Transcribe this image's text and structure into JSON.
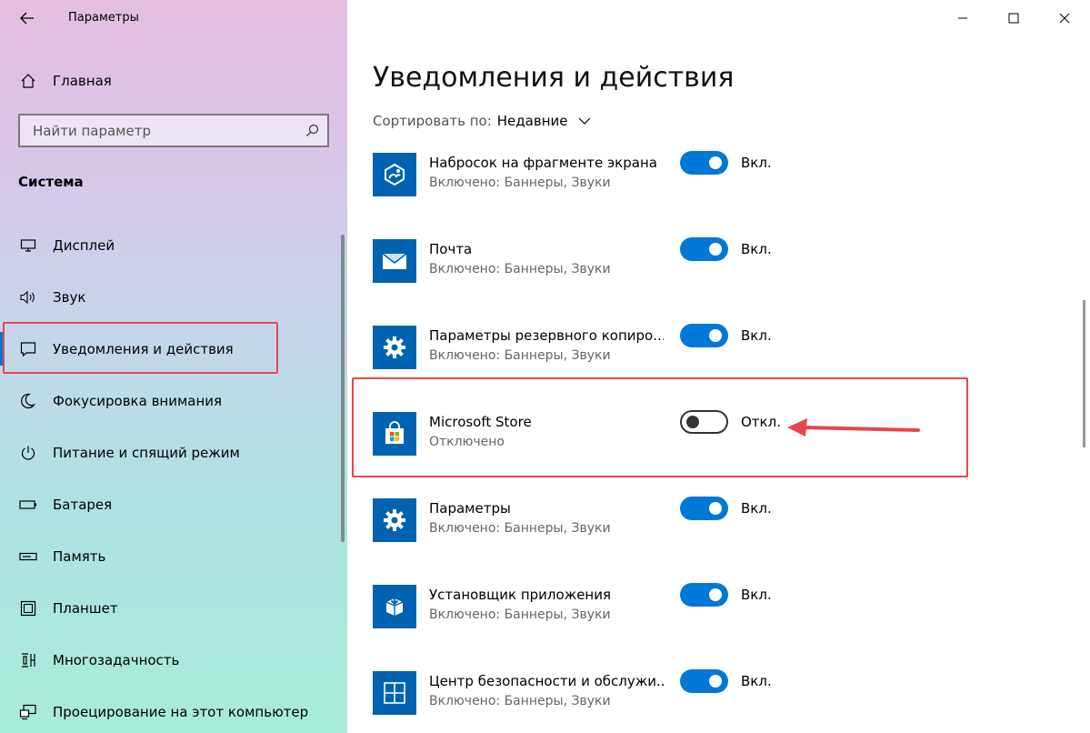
{
  "window": {
    "title": "Параметры"
  },
  "sidebar": {
    "home_label": "Главная",
    "search": {
      "placeholder": "Найти параметр"
    },
    "section_title": "Система",
    "items": [
      {
        "label": "Дисплей",
        "icon": "display-icon"
      },
      {
        "label": "Звук",
        "icon": "speaker-icon"
      },
      {
        "label": "Уведомления и действия",
        "icon": "notification-icon",
        "selected": true
      },
      {
        "label": "Фокусировка внимания",
        "icon": "moon-icon"
      },
      {
        "label": "Питание и спящий режим",
        "icon": "power-icon"
      },
      {
        "label": "Батарея",
        "icon": "battery-icon"
      },
      {
        "label": "Память",
        "icon": "storage-icon"
      },
      {
        "label": "Планшет",
        "icon": "tablet-icon"
      },
      {
        "label": "Многозадачность",
        "icon": "multitask-icon"
      },
      {
        "label": "Проецирование на этот компьютер",
        "icon": "project-icon"
      }
    ]
  },
  "main": {
    "title": "Уведомления и действия",
    "sort": {
      "label": "Сортировать по:",
      "value": "Недавние"
    },
    "apps": [
      {
        "name": "Набросок на фрагменте экрана",
        "status": "Включено: Баннеры, Звуки",
        "toggle": "Вкл.",
        "on": true,
        "icon": "snip-sketch-icon"
      },
      {
        "name": "Почта",
        "status": "Включено: Баннеры, Звуки",
        "toggle": "Вкл.",
        "on": true,
        "icon": "mail-icon"
      },
      {
        "name": "Параметры резервного копиро...",
        "status": "Включено: Баннеры, Звуки",
        "toggle": "Вкл.",
        "on": true,
        "icon": "gear-icon"
      },
      {
        "name": "Microsoft Store",
        "status": "Отключено",
        "toggle": "Откл.",
        "on": false,
        "icon": "store-icon"
      },
      {
        "name": "Параметры",
        "status": "Включено: Баннеры, Звуки",
        "toggle": "Вкл.",
        "on": true,
        "icon": "gear-icon"
      },
      {
        "name": "Установщик приложения",
        "status": "Включено: Баннеры, Звуки",
        "toggle": "Вкл.",
        "on": true,
        "icon": "app-installer-icon"
      },
      {
        "name": "Центр безопасности и обслужи...",
        "status": "Включено: Баннеры, Звуки",
        "toggle": "Вкл.",
        "on": true,
        "icon": "security-center-icon"
      }
    ]
  },
  "colors": {
    "accent": "#0078d7",
    "tile": "#0063b1",
    "annotation": "#e8464c"
  }
}
